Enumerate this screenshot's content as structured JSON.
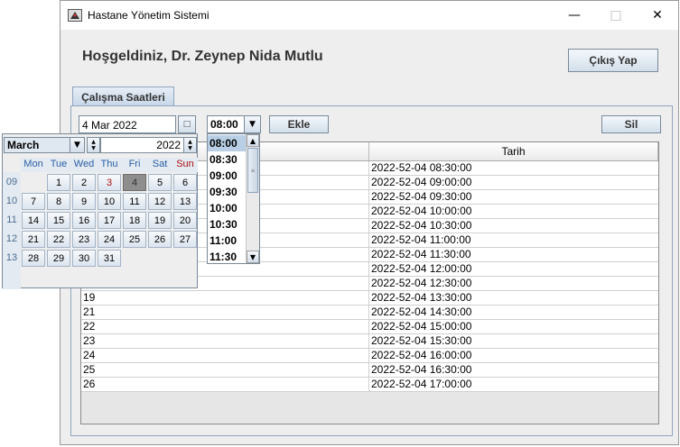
{
  "window": {
    "title": "Hastane Yönetim Sistemi"
  },
  "header": {
    "welcome": "Hoşgeldiniz, Dr. Zeynep Nida Mutlu",
    "logout_label": "Çıkış Yap"
  },
  "tabs": [
    {
      "label": "Çalışma Saatleri"
    }
  ],
  "toolbar": {
    "date_value": "4 Mar 2022",
    "time_value": "08:00",
    "add_label": "Ekle",
    "delete_label": "Sil"
  },
  "table": {
    "columns": [
      "",
      "Tarih"
    ],
    "rows": [
      {
        "id": "",
        "date": "2022-52-04 08:30:00"
      },
      {
        "id": "",
        "date": "2022-52-04 09:00:00"
      },
      {
        "id": "",
        "date": "2022-52-04 09:30:00"
      },
      {
        "id": "",
        "date": "2022-52-04 10:00:00"
      },
      {
        "id": "",
        "date": "2022-52-04 10:30:00"
      },
      {
        "id": "",
        "date": "2022-52-04 11:00:00"
      },
      {
        "id": "",
        "date": "2022-52-04 11:30:00"
      },
      {
        "id": "",
        "date": "2022-52-04 12:00:00"
      },
      {
        "id": "",
        "date": "2022-52-04 12:30:00"
      },
      {
        "id": "19",
        "date": "2022-52-04 13:30:00"
      },
      {
        "id": "21",
        "date": "2022-52-04 14:30:00"
      },
      {
        "id": "22",
        "date": "2022-52-04 15:00:00"
      },
      {
        "id": "23",
        "date": "2022-52-04 15:30:00"
      },
      {
        "id": "24",
        "date": "2022-52-04 16:00:00"
      },
      {
        "id": "25",
        "date": "2022-52-04 16:30:00"
      },
      {
        "id": "26",
        "date": "2022-52-04 17:00:00"
      }
    ]
  },
  "calendar": {
    "month": "March",
    "year": "2022",
    "day_names": [
      "Mon",
      "Tue",
      "Wed",
      "Thu",
      "Fri",
      "Sat",
      "Sun"
    ],
    "weeks": [
      {
        "num": "09",
        "days": [
          "",
          "1",
          "2",
          "3",
          "4",
          "5",
          "6"
        ]
      },
      {
        "num": "10",
        "days": [
          "7",
          "8",
          "9",
          "10",
          "11",
          "12",
          "13"
        ]
      },
      {
        "num": "11",
        "days": [
          "14",
          "15",
          "16",
          "17",
          "18",
          "19",
          "20"
        ]
      },
      {
        "num": "12",
        "days": [
          "21",
          "22",
          "23",
          "24",
          "25",
          "26",
          "27"
        ]
      },
      {
        "num": "13",
        "days": [
          "28",
          "29",
          "30",
          "31",
          "",
          "",
          ""
        ]
      }
    ],
    "selected_day": "4",
    "today_day": "3"
  },
  "time_options": [
    "08:00",
    "08:30",
    "09:00",
    "09:30",
    "10:00",
    "10:30",
    "11:00",
    "11:30"
  ],
  "colors": {
    "accent": "#b8cfe5",
    "sunday": "#b01010",
    "weekday": "#2a5fa5"
  }
}
